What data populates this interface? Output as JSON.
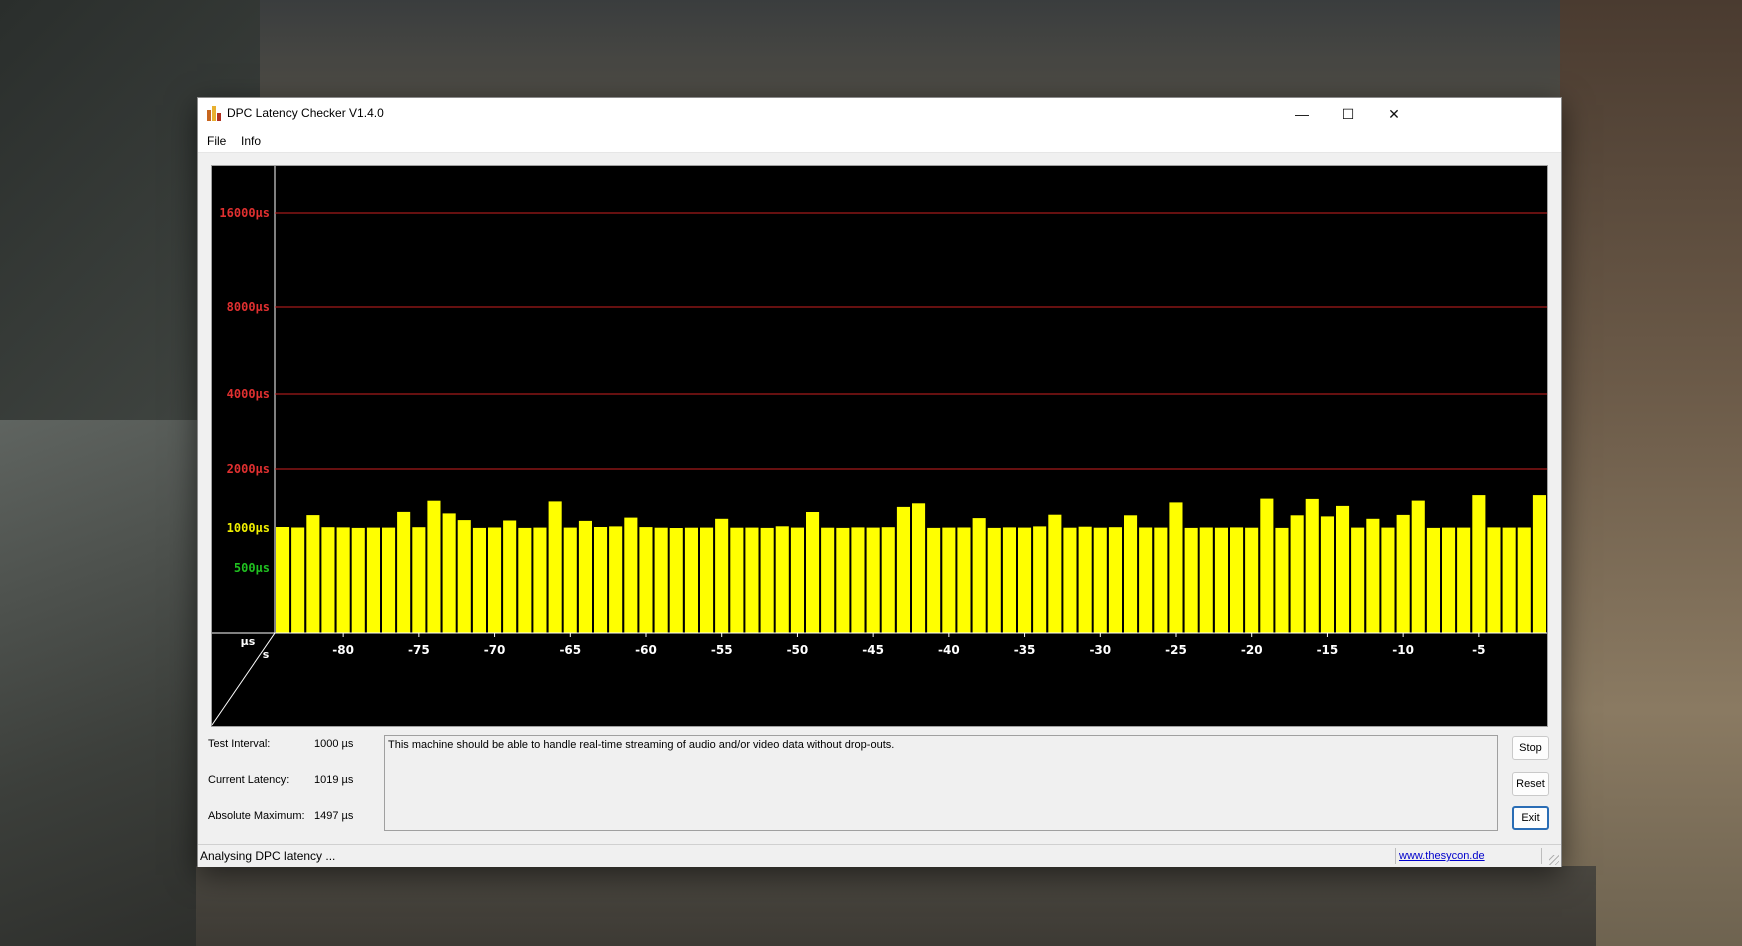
{
  "window": {
    "title": "DPC Latency Checker V1.4.0",
    "controls": {
      "minimize": "—",
      "maximize": "☐",
      "close": "✕"
    }
  },
  "menu": {
    "items": [
      "File",
      "Info"
    ]
  },
  "chart_data": {
    "type": "bar",
    "y_scale": "log",
    "y_unit": "µs",
    "x_unit": "s",
    "reference_lines": [
      {
        "label": "16000µs",
        "value": 16000,
        "color": "#e03030"
      },
      {
        "label": "8000µs",
        "value": 8000,
        "color": "#e03030"
      },
      {
        "label": "4000µs",
        "value": 4000,
        "color": "#e03030"
      },
      {
        "label": "2000µs",
        "value": 2000,
        "color": "#e03030"
      },
      {
        "label": "1000µs",
        "value": 1000,
        "color": "#f0f000"
      },
      {
        "label": "500µs",
        "value": 500,
        "color": "#20c020"
      }
    ],
    "x_ticks": [
      -80,
      -75,
      -70,
      -65,
      -60,
      -55,
      -50,
      -45,
      -40,
      -35,
      -30,
      -25,
      -20,
      -15,
      -10,
      -5
    ],
    "x_range": [
      -84,
      0
    ],
    "bar_color": "#ffff00",
    "bars_per_second": 1,
    "values": [
      1008,
      1004,
      1099,
      1006,
      1005,
      1001,
      1003,
      1003,
      1124,
      1006,
      1210,
      1112,
      1061,
      1001,
      1004,
      1058,
      1001,
      1003,
      1205,
      1003,
      1055,
      1008,
      1012,
      1080,
      1007,
      1002,
      1000,
      1002,
      1003,
      1071,
      1002,
      1003,
      1001,
      1013,
      1003,
      1123,
      1002,
      1001,
      1005,
      1003,
      1006,
      1162,
      1190,
      1001,
      1003,
      1004,
      1076,
      1001,
      1005,
      1003,
      1012,
      1102,
      1002,
      1010,
      1002,
      1006,
      1098,
      1004,
      1003,
      1197,
      1001,
      1004,
      1002,
      1005,
      1002,
      1226,
      1001,
      1098,
      1224,
      1089,
      1170,
      1003,
      1071,
      1003,
      1101,
      1211,
      1001,
      1003,
      1003,
      1253,
      1005,
      1003,
      1004,
      1253
    ]
  },
  "stats": {
    "test_interval_label": "Test Interval:",
    "test_interval_value": "1000 µs",
    "current_latency_label": "Current Latency:",
    "current_latency_value": "1019 µs",
    "absolute_maximum_label": "Absolute Maximum:",
    "absolute_maximum_value": "1497 µs"
  },
  "message": "This machine should be able to handle real-time streaming of audio and/or video data without drop-outs.",
  "buttons": {
    "stop": "Stop",
    "reset": "Reset",
    "exit": "Exit"
  },
  "status": {
    "text": "Analysing DPC latency ...",
    "link": "www.thesycon.de"
  }
}
